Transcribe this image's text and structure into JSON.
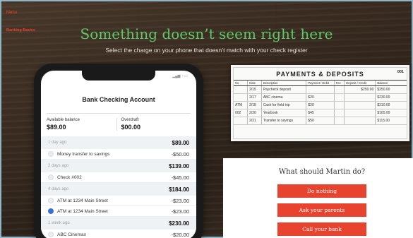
{
  "nav": {
    "menu": "Menu",
    "section": "Banking Basics"
  },
  "header": {
    "title": "Something doesn’t seem right here",
    "subtitle": "Select the charge on your phone that doesn’t match with your check register"
  },
  "phone": {
    "account_title": "Bank Checking Account",
    "available_label": "Available balance",
    "available_value": "$89.00",
    "overdraft_label": "Overdraft",
    "overdraft_value": "$00.00",
    "groups": [
      {
        "label": "1 day ago",
        "total": "$89.00",
        "items": [
          {
            "desc": "Money transfer to savings",
            "amount": "-$50.00",
            "selected": false
          }
        ]
      },
      {
        "label": "2 days ago",
        "total": "$139.00",
        "items": [
          {
            "desc": "Check #002",
            "amount": "-$45.00",
            "selected": false
          }
        ]
      },
      {
        "label": "4 days ago",
        "total": "$184.00",
        "items": [
          {
            "desc": "ATM at 1234 Main Street",
            "amount": "-$23.00",
            "selected": false
          },
          {
            "desc": "ATM at 1234 Main Street",
            "amount": "-$23.00",
            "selected": true
          }
        ]
      },
      {
        "label": "1 week ago",
        "total": "$230.00",
        "items": [
          {
            "desc": "ABC Cinemas",
            "amount": "-$20.00",
            "selected": false
          }
        ]
      }
    ]
  },
  "register": {
    "title": "PAYMENTS & DEPOSITS",
    "number": "001",
    "columns": [
      "No",
      "Date",
      "Description",
      "Payment / Debit",
      "Fee",
      "Deposit / Credit",
      "Balance"
    ],
    "rows": [
      [
        "",
        "2/15",
        "Paycheck deposit",
        "",
        "",
        "$250.00",
        "$250.00"
      ],
      [
        "",
        "2/17",
        "ABC cinema",
        "$20",
        "",
        "",
        "$230.00"
      ],
      [
        "ATM",
        "2/18",
        "Cash for field trip",
        "$20",
        "",
        "",
        "$210.00"
      ],
      [
        "002",
        "2/20",
        "Yearbook",
        "$45",
        "",
        "",
        "$165.00"
      ],
      [
        "",
        "2/21",
        "Transfer to savings",
        "$50",
        "",
        "",
        "$115.00"
      ]
    ]
  },
  "question": {
    "title": "What should Martin do?",
    "options": [
      "Do nothing",
      "Ask your parents",
      "Call your bank"
    ]
  },
  "colors": {
    "accent": "#e8432f",
    "headline": "#5ec96a",
    "selected": "#3b6fd8"
  }
}
